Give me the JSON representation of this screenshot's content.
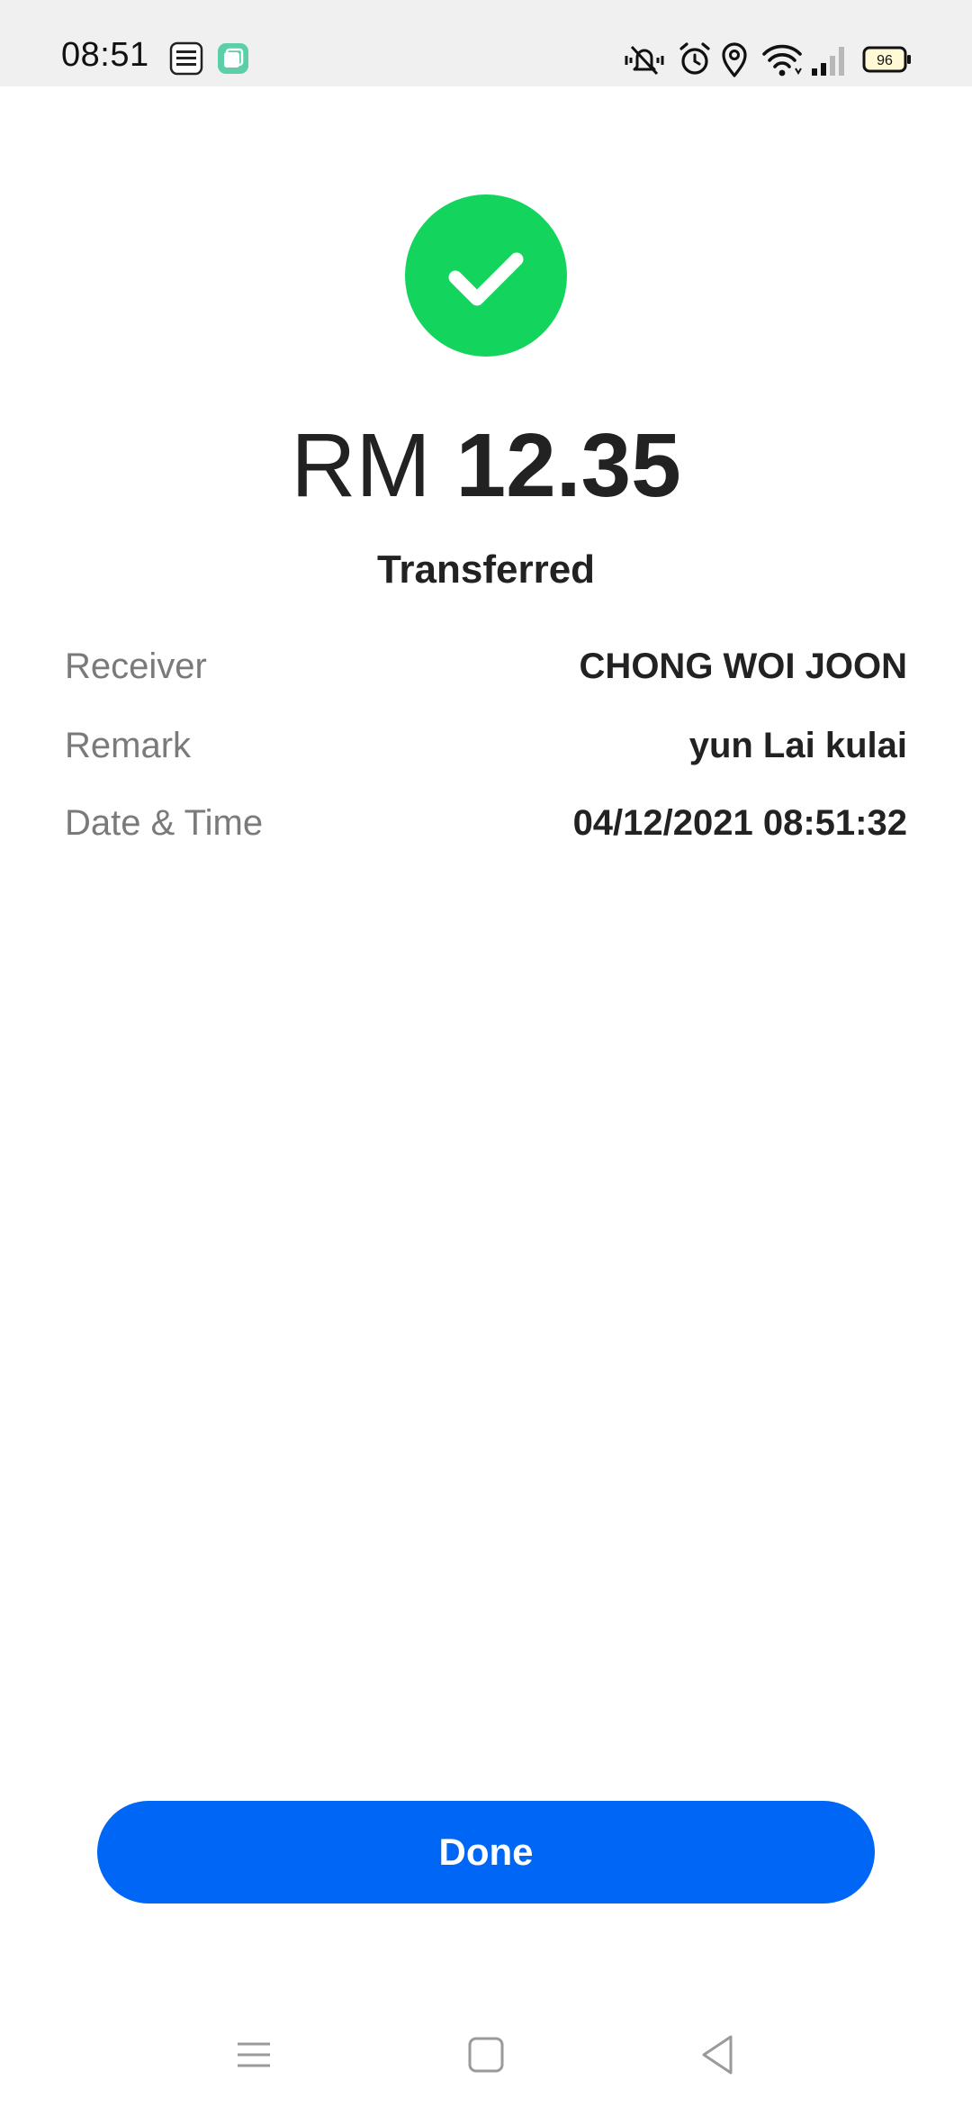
{
  "status_bar": {
    "time": "08:51",
    "app_icons": [
      "touch-n-go-ewallet-icon",
      "notification-app-icon"
    ],
    "right_icons": [
      "vibrate-mute-icon",
      "alarm-icon",
      "location-icon",
      "wifi-icon",
      "cellular-signal-icon",
      "battery-icon"
    ],
    "battery_level": "96"
  },
  "result": {
    "icon": "check-icon",
    "icon_color": "#13d45c",
    "currency": "RM",
    "amount": "12.35",
    "status": "Transferred"
  },
  "details": [
    {
      "label": "Receiver",
      "value": "CHONG WOI JOON"
    },
    {
      "label": "Remark",
      "value": "yun Lai kulai"
    },
    {
      "label": "Date & Time",
      "value": "04/12/2021 08:51:32"
    }
  ],
  "actions": {
    "done_label": "Done",
    "button_color": "#0066f5"
  },
  "nav_bar": {
    "icons": [
      "menu-icon",
      "home-icon",
      "back-icon"
    ]
  }
}
